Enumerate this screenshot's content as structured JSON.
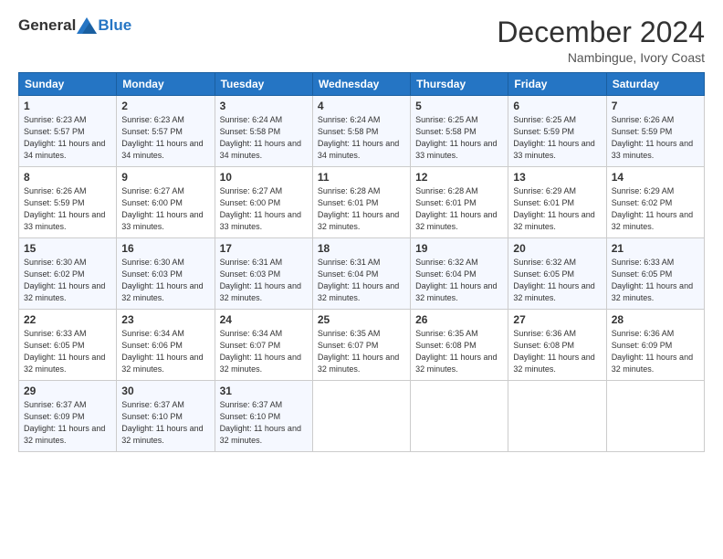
{
  "logo": {
    "general": "General",
    "blue": "Blue"
  },
  "header": {
    "month": "December 2024",
    "location": "Nambingue, Ivory Coast"
  },
  "weekdays": [
    "Sunday",
    "Monday",
    "Tuesday",
    "Wednesday",
    "Thursday",
    "Friday",
    "Saturday"
  ],
  "weeks": [
    [
      {
        "day": "1",
        "sunrise": "Sunrise: 6:23 AM",
        "sunset": "Sunset: 5:57 PM",
        "daylight": "Daylight: 11 hours and 34 minutes."
      },
      {
        "day": "2",
        "sunrise": "Sunrise: 6:23 AM",
        "sunset": "Sunset: 5:57 PM",
        "daylight": "Daylight: 11 hours and 34 minutes."
      },
      {
        "day": "3",
        "sunrise": "Sunrise: 6:24 AM",
        "sunset": "Sunset: 5:58 PM",
        "daylight": "Daylight: 11 hours and 34 minutes."
      },
      {
        "day": "4",
        "sunrise": "Sunrise: 6:24 AM",
        "sunset": "Sunset: 5:58 PM",
        "daylight": "Daylight: 11 hours and 34 minutes."
      },
      {
        "day": "5",
        "sunrise": "Sunrise: 6:25 AM",
        "sunset": "Sunset: 5:58 PM",
        "daylight": "Daylight: 11 hours and 33 minutes."
      },
      {
        "day": "6",
        "sunrise": "Sunrise: 6:25 AM",
        "sunset": "Sunset: 5:59 PM",
        "daylight": "Daylight: 11 hours and 33 minutes."
      },
      {
        "day": "7",
        "sunrise": "Sunrise: 6:26 AM",
        "sunset": "Sunset: 5:59 PM",
        "daylight": "Daylight: 11 hours and 33 minutes."
      }
    ],
    [
      {
        "day": "8",
        "sunrise": "Sunrise: 6:26 AM",
        "sunset": "Sunset: 5:59 PM",
        "daylight": "Daylight: 11 hours and 33 minutes."
      },
      {
        "day": "9",
        "sunrise": "Sunrise: 6:27 AM",
        "sunset": "Sunset: 6:00 PM",
        "daylight": "Daylight: 11 hours and 33 minutes."
      },
      {
        "day": "10",
        "sunrise": "Sunrise: 6:27 AM",
        "sunset": "Sunset: 6:00 PM",
        "daylight": "Daylight: 11 hours and 33 minutes."
      },
      {
        "day": "11",
        "sunrise": "Sunrise: 6:28 AM",
        "sunset": "Sunset: 6:01 PM",
        "daylight": "Daylight: 11 hours and 32 minutes."
      },
      {
        "day": "12",
        "sunrise": "Sunrise: 6:28 AM",
        "sunset": "Sunset: 6:01 PM",
        "daylight": "Daylight: 11 hours and 32 minutes."
      },
      {
        "day": "13",
        "sunrise": "Sunrise: 6:29 AM",
        "sunset": "Sunset: 6:01 PM",
        "daylight": "Daylight: 11 hours and 32 minutes."
      },
      {
        "day": "14",
        "sunrise": "Sunrise: 6:29 AM",
        "sunset": "Sunset: 6:02 PM",
        "daylight": "Daylight: 11 hours and 32 minutes."
      }
    ],
    [
      {
        "day": "15",
        "sunrise": "Sunrise: 6:30 AM",
        "sunset": "Sunset: 6:02 PM",
        "daylight": "Daylight: 11 hours and 32 minutes."
      },
      {
        "day": "16",
        "sunrise": "Sunrise: 6:30 AM",
        "sunset": "Sunset: 6:03 PM",
        "daylight": "Daylight: 11 hours and 32 minutes."
      },
      {
        "day": "17",
        "sunrise": "Sunrise: 6:31 AM",
        "sunset": "Sunset: 6:03 PM",
        "daylight": "Daylight: 11 hours and 32 minutes."
      },
      {
        "day": "18",
        "sunrise": "Sunrise: 6:31 AM",
        "sunset": "Sunset: 6:04 PM",
        "daylight": "Daylight: 11 hours and 32 minutes."
      },
      {
        "day": "19",
        "sunrise": "Sunrise: 6:32 AM",
        "sunset": "Sunset: 6:04 PM",
        "daylight": "Daylight: 11 hours and 32 minutes."
      },
      {
        "day": "20",
        "sunrise": "Sunrise: 6:32 AM",
        "sunset": "Sunset: 6:05 PM",
        "daylight": "Daylight: 11 hours and 32 minutes."
      },
      {
        "day": "21",
        "sunrise": "Sunrise: 6:33 AM",
        "sunset": "Sunset: 6:05 PM",
        "daylight": "Daylight: 11 hours and 32 minutes."
      }
    ],
    [
      {
        "day": "22",
        "sunrise": "Sunrise: 6:33 AM",
        "sunset": "Sunset: 6:05 PM",
        "daylight": "Daylight: 11 hours and 32 minutes."
      },
      {
        "day": "23",
        "sunrise": "Sunrise: 6:34 AM",
        "sunset": "Sunset: 6:06 PM",
        "daylight": "Daylight: 11 hours and 32 minutes."
      },
      {
        "day": "24",
        "sunrise": "Sunrise: 6:34 AM",
        "sunset": "Sunset: 6:07 PM",
        "daylight": "Daylight: 11 hours and 32 minutes."
      },
      {
        "day": "25",
        "sunrise": "Sunrise: 6:35 AM",
        "sunset": "Sunset: 6:07 PM",
        "daylight": "Daylight: 11 hours and 32 minutes."
      },
      {
        "day": "26",
        "sunrise": "Sunrise: 6:35 AM",
        "sunset": "Sunset: 6:08 PM",
        "daylight": "Daylight: 11 hours and 32 minutes."
      },
      {
        "day": "27",
        "sunrise": "Sunrise: 6:36 AM",
        "sunset": "Sunset: 6:08 PM",
        "daylight": "Daylight: 11 hours and 32 minutes."
      },
      {
        "day": "28",
        "sunrise": "Sunrise: 6:36 AM",
        "sunset": "Sunset: 6:09 PM",
        "daylight": "Daylight: 11 hours and 32 minutes."
      }
    ],
    [
      {
        "day": "29",
        "sunrise": "Sunrise: 6:37 AM",
        "sunset": "Sunset: 6:09 PM",
        "daylight": "Daylight: 11 hours and 32 minutes."
      },
      {
        "day": "30",
        "sunrise": "Sunrise: 6:37 AM",
        "sunset": "Sunset: 6:10 PM",
        "daylight": "Daylight: 11 hours and 32 minutes."
      },
      {
        "day": "31",
        "sunrise": "Sunrise: 6:37 AM",
        "sunset": "Sunset: 6:10 PM",
        "daylight": "Daylight: 11 hours and 32 minutes."
      },
      null,
      null,
      null,
      null
    ]
  ]
}
